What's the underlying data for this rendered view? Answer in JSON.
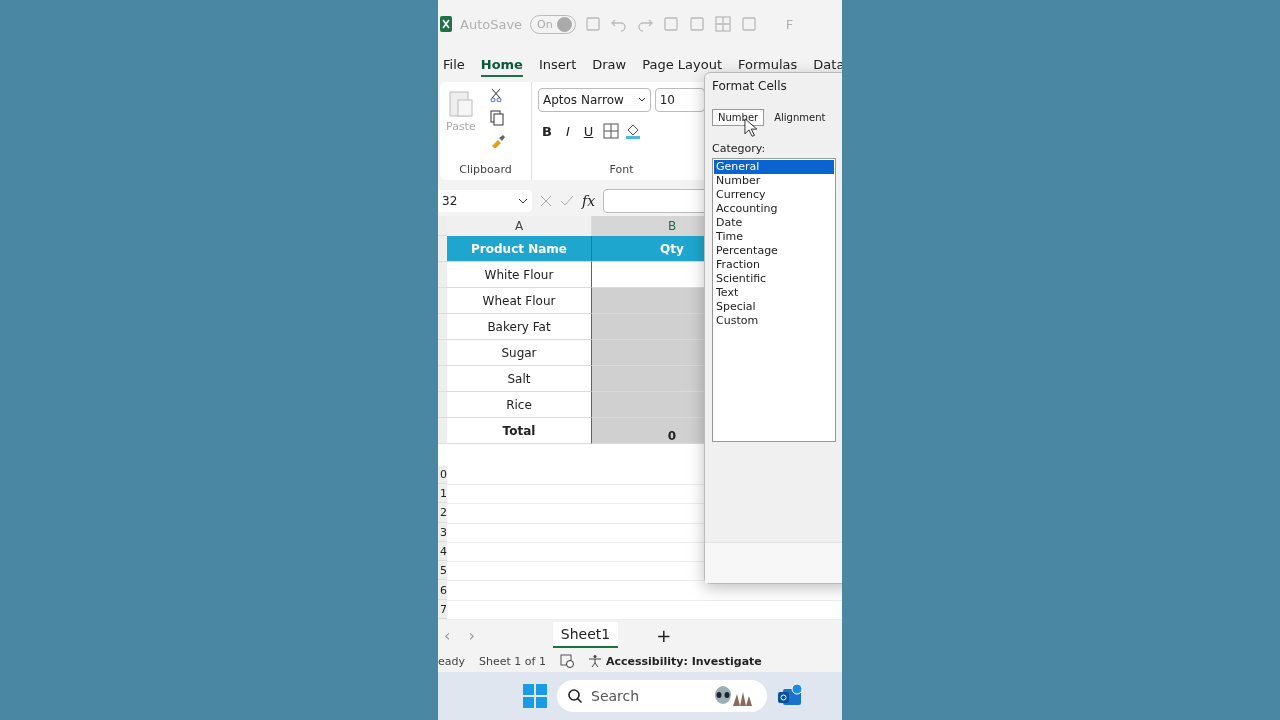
{
  "title_bar": {
    "autosave_label": "AutoSave",
    "autosave_toggle": {
      "label": "On",
      "on": true
    },
    "title_fragment": "F"
  },
  "ribbon_tabs": [
    {
      "label": "File",
      "selected": false
    },
    {
      "label": "Home",
      "selected": true
    },
    {
      "label": "Insert",
      "selected": false
    },
    {
      "label": "Draw",
      "selected": false
    },
    {
      "label": "Page Layout",
      "selected": false
    },
    {
      "label": "Formulas",
      "selected": false
    },
    {
      "label": "Data",
      "selected": false
    }
  ],
  "ribbon": {
    "clipboard": {
      "paste_label": "Paste",
      "group_label": "Clipboard"
    },
    "font": {
      "font_name": "Aptos Narrow",
      "font_size": "10",
      "bold": "B",
      "italic": "I",
      "underline": "U",
      "group_label": "Font"
    }
  },
  "formula_bar": {
    "name_box": "32",
    "fx": "fx"
  },
  "sheet": {
    "column_headers": [
      {
        "label": "A",
        "selected": false
      },
      {
        "label": "B",
        "selected": true
      }
    ],
    "header_row": [
      "Product Name",
      "Qty"
    ],
    "rows": [
      {
        "product": "White Flour",
        "qty_selected": false
      },
      {
        "product": "Wheat Flour",
        "qty_selected": true
      },
      {
        "product": "Bakery Fat",
        "qty_selected": true
      },
      {
        "product": "Sugar",
        "qty_selected": true
      },
      {
        "product": "Salt",
        "qty_selected": true
      },
      {
        "product": "Rice",
        "qty_selected": true
      }
    ],
    "total_row": {
      "label": "Total",
      "qty": "0",
      "qty_selected": true
    },
    "row_numbers": [
      "0",
      "1",
      "2",
      "3",
      "4",
      "5",
      "6",
      "7"
    ]
  },
  "sheet_tabs": {
    "prev": "‹",
    "next": "›",
    "tabs": [
      {
        "label": "Sheet1",
        "selected": true
      }
    ],
    "add": "+"
  },
  "status_bar": {
    "mode": "eady",
    "sheet_info": "Sheet 1 of 1",
    "accessibility": "Accessibility: Investigate"
  },
  "taskbar": {
    "search_placeholder": "Search"
  },
  "dialog": {
    "title": "Format Cells",
    "tabs": [
      {
        "label": "Number",
        "selected": true
      },
      {
        "label": "Alignment",
        "selected": false
      }
    ],
    "category_label": "Category:",
    "categories": [
      {
        "label": "General",
        "selected": true
      },
      {
        "label": "Number",
        "selected": false
      },
      {
        "label": "Currency",
        "selected": false
      },
      {
        "label": "Accounting",
        "selected": false
      },
      {
        "label": "Date",
        "selected": false
      },
      {
        "label": "Time",
        "selected": false
      },
      {
        "label": "Percentage",
        "selected": false
      },
      {
        "label": "Fraction",
        "selected": false
      },
      {
        "label": "Scientific",
        "selected": false
      },
      {
        "label": "Text",
        "selected": false
      },
      {
        "label": "Special",
        "selected": false
      },
      {
        "label": "Custom",
        "selected": false
      }
    ]
  }
}
